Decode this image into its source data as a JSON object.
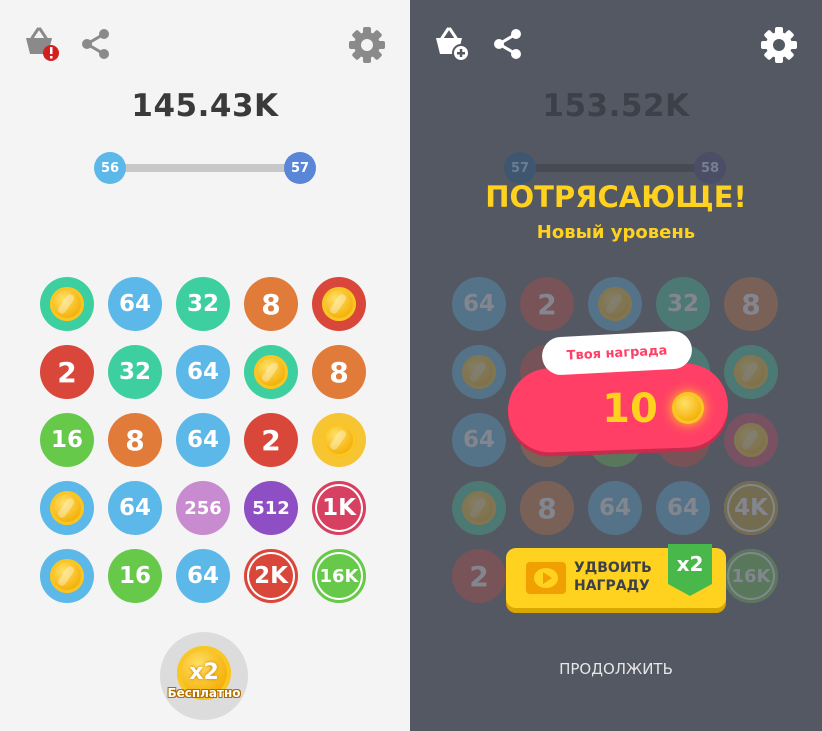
{
  "left": {
    "score": "145.43K",
    "level_from": "56",
    "level_to": "57",
    "free_bonus": {
      "multiplier": "x2",
      "label": "Бесплатно"
    },
    "grid": [
      [
        {
          "t": "coin",
          "bg": "#3ecfa0"
        },
        {
          "t": "64",
          "bg": "#5bb8e8"
        },
        {
          "t": "32",
          "bg": "#3ecfa0"
        },
        {
          "t": "8",
          "bg": "#e07b3a"
        },
        {
          "t": "coin",
          "bg": "#d9473b"
        }
      ],
      [
        {
          "t": "2",
          "bg": "#d9473b"
        },
        {
          "t": "32",
          "bg": "#3ecfa0"
        },
        {
          "t": "64",
          "bg": "#5bb8e8"
        },
        {
          "t": "coin",
          "bg": "#3ecfa0"
        },
        {
          "t": "8",
          "bg": "#e07b3a"
        }
      ],
      [
        {
          "t": "16",
          "bg": "#67c94a"
        },
        {
          "t": "8",
          "bg": "#e07b3a"
        },
        {
          "t": "64",
          "bg": "#5bb8e8"
        },
        {
          "t": "2",
          "bg": "#d9473b"
        },
        {
          "t": "coin",
          "bg": "#f6c531"
        }
      ],
      [
        {
          "t": "coin",
          "bg": "#5bb8e8"
        },
        {
          "t": "64",
          "bg": "#5bb8e8"
        },
        {
          "t": "256",
          "bg": "#c88bd0"
        },
        {
          "t": "512",
          "bg": "#8e4fc4"
        },
        {
          "t": "1K",
          "bg": "#d74060",
          "ring": true
        }
      ],
      [
        {
          "t": "coin",
          "bg": "#5bb8e8"
        },
        {
          "t": "16",
          "bg": "#67c94a"
        },
        {
          "t": "64",
          "bg": "#5bb8e8"
        },
        {
          "t": "2K",
          "bg": "#d9473b",
          "ring": true
        },
        {
          "t": "16K",
          "bg": "#67c94a",
          "ring": true
        }
      ]
    ]
  },
  "right": {
    "score": "153.52K",
    "level_from": "57",
    "level_to": "58",
    "headline": "ПОТРЯСАЮЩЕ!",
    "subheadline": "Новый уровень",
    "reward_label": "Твоя награда",
    "reward_amount": "10",
    "double_button": {
      "line1": "УДВОИТЬ",
      "line2": "НАГРАДУ",
      "badge": "x2"
    },
    "continue_label": "ПРОДОЛЖИТЬ",
    "grid": [
      [
        {
          "t": "64",
          "bg": "#5bb8e8"
        },
        {
          "t": "2",
          "bg": "#d9473b"
        },
        {
          "t": "coin",
          "bg": "#5bb8e8"
        },
        {
          "t": "32",
          "bg": "#3ecfa0"
        },
        {
          "t": "8",
          "bg": "#e07b3a"
        }
      ],
      [
        {
          "t": "coin",
          "bg": "#5bb8e8"
        },
        {
          "t": "",
          "bg": "#d9473b"
        },
        {
          "t": "",
          "bg": "#3ecfa0"
        },
        {
          "t": "",
          "bg": "#3ecfa0"
        },
        {
          "t": "coin",
          "bg": "#3ecfa0"
        }
      ],
      [
        {
          "t": "64",
          "bg": "#5bb8e8"
        },
        {
          "t": "",
          "bg": "#e07b3a"
        },
        {
          "t": "",
          "bg": "#67c94a"
        },
        {
          "t": "",
          "bg": "#d9473b"
        },
        {
          "t": "coin",
          "bg": "#d74060"
        }
      ],
      [
        {
          "t": "coin",
          "bg": "#3ecfa0"
        },
        {
          "t": "8",
          "bg": "#e07b3a"
        },
        {
          "t": "64",
          "bg": "#5bb8e8"
        },
        {
          "t": "64",
          "bg": "#5bb8e8"
        },
        {
          "t": "4K",
          "bg": "#c8a020",
          "ring": true
        }
      ],
      [
        {
          "t": "2",
          "bg": "#d9473b"
        },
        {
          "t": "",
          "bg": "#535863"
        },
        {
          "t": "",
          "bg": "#535863"
        },
        {
          "t": "",
          "bg": "#535863"
        },
        {
          "t": "16K",
          "bg": "#67c94a",
          "ring": true
        }
      ]
    ]
  },
  "colors": {
    "accent_yellow": "#ffd21f",
    "reward_pink": "#ff3f66",
    "level_blue": "#5aa0e0"
  },
  "icons": [
    "basket-alert-icon",
    "share-icon",
    "gear-icon",
    "basket-add-icon",
    "video-icon",
    "coin-icon"
  ]
}
